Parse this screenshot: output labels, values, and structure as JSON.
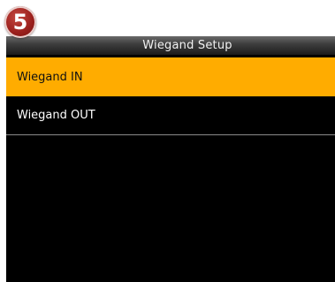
{
  "step_badge": {
    "number": "5",
    "color": "#a02420"
  },
  "window": {
    "title": "Wiegand Setup"
  },
  "menu": {
    "items": [
      {
        "label": "Wiegand IN",
        "selected": true
      },
      {
        "label": "Wiegand OUT",
        "selected": false
      }
    ]
  },
  "colors": {
    "highlight": "#ffac00",
    "screen_background": "#000000",
    "title_bar": "#3f3f3f"
  }
}
